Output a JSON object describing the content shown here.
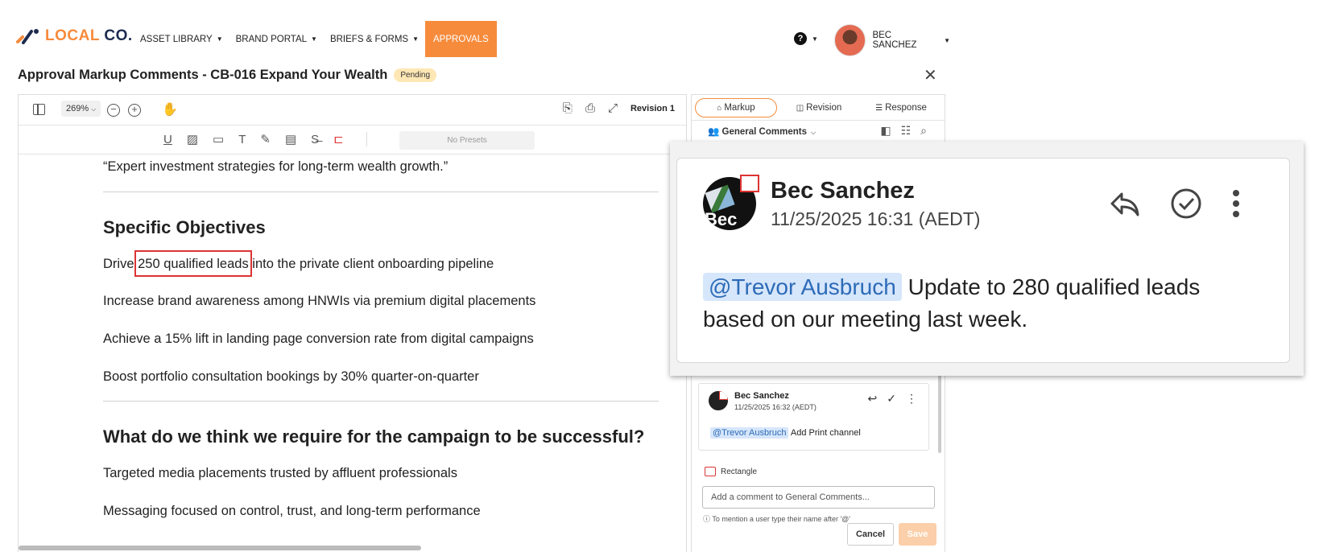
{
  "brand": {
    "logo_local": "LOCAL",
    "logo_co": "CO."
  },
  "nav": {
    "items": [
      {
        "label": "ASSET LIBRARY"
      },
      {
        "label": "BRAND PORTAL"
      },
      {
        "label": "BRIEFS & FORMS"
      },
      {
        "label": "APPROVALS"
      }
    ],
    "user_name": "BEC SANCHEZ"
  },
  "header": {
    "title": "Approval Markup Comments - CB-016 Expand Your Wealth",
    "status": "Pending"
  },
  "viewer": {
    "zoom": "269%",
    "revision": "Revision 1",
    "presets_placeholder": "No Presets",
    "content": {
      "quote": "“Expert investment strategies for long-term wealth growth.”",
      "heading1": "Specific Objectives",
      "objectives": [
        "Drive 250 qualified leads into the private client onboarding pipeline",
        "Increase brand awareness among HNWIs via premium digital placements",
        "Achieve a 15% lift in landing page conversion rate from digital campaigns",
        "Boost portfolio consultation bookings by 30% quarter-on-quarter"
      ],
      "heading2": "What do we think we require for the campaign to be successful?",
      "requirements": [
        "Targeted media placements trusted by affluent professionals",
        "Messaging focused on control, trust, and long-term performance"
      ]
    }
  },
  "panel": {
    "tabs": [
      {
        "label": "Markup"
      },
      {
        "label": "Revision"
      },
      {
        "label": "Response"
      }
    ],
    "group_label": "General Comments",
    "comment2": {
      "author": "Bec Sanchez",
      "timestamp": "11/25/2025 16:32 (AEDT)",
      "mention": "@Trevor Ausbruch",
      "text": "Add Print channel"
    },
    "shape_label": "Rectangle",
    "input_placeholder": "Add a comment to General Comments...",
    "hint": "To mention a user type their name after '@'",
    "cancel_label": "Cancel",
    "save_label": "Save"
  },
  "callout": {
    "author": "Bec Sanchez",
    "avatar_text": "Bec",
    "timestamp": "11/25/2025 16:31 (AEDT)",
    "mention": "@Trevor Ausbruch",
    "text_line1": "Update to 280 qualified leads",
    "text_line2": "based on our meeting last week."
  },
  "colors": {
    "accent": "#f68b3c",
    "markup_red": "#d33333",
    "mention_bg": "#d6e6fb",
    "pending_bg": "#fde7b4"
  }
}
